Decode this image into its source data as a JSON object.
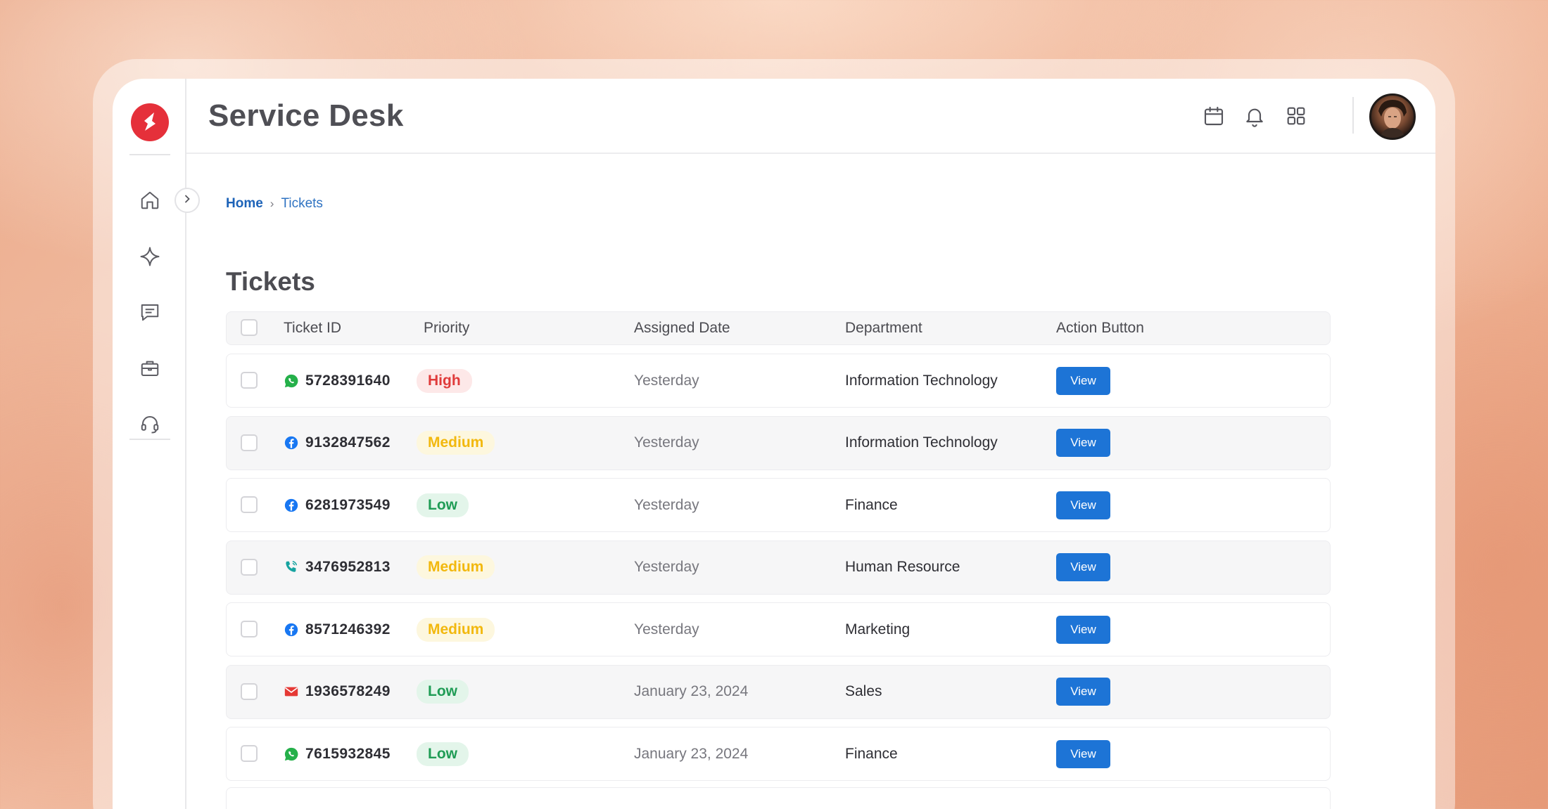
{
  "header": {
    "title": "Service Desk",
    "icons": [
      "calendar-icon",
      "bell-icon",
      "apps-grid-icon"
    ]
  },
  "sidebar": {
    "items": [
      "home-icon",
      "sparkle-icon",
      "chat-icon",
      "briefcase-icon",
      "headset-icon"
    ]
  },
  "breadcrumb": {
    "home": "Home",
    "separator": "›",
    "current": "Tickets"
  },
  "main": {
    "title": "Tickets",
    "columns": [
      "Ticket ID",
      "Priority",
      "Assigned Date",
      "Department",
      "Action Button"
    ],
    "rows": [
      {
        "channel": "whatsapp",
        "id": "5728391640",
        "priority": "High",
        "level": "high",
        "date": "Yesterday",
        "department": "Information Technology",
        "action": "View"
      },
      {
        "channel": "facebook",
        "id": "9132847562",
        "priority": "Medium",
        "level": "medium",
        "date": "Yesterday",
        "department": "Information Technology",
        "action": "View"
      },
      {
        "channel": "facebook",
        "id": "6281973549",
        "priority": "Low",
        "level": "low",
        "date": "Yesterday",
        "department": "Finance",
        "action": "View"
      },
      {
        "channel": "phone",
        "id": "3476952813",
        "priority": "Medium",
        "level": "medium",
        "date": "Yesterday",
        "department": "Human Resource",
        "action": "View"
      },
      {
        "channel": "facebook",
        "id": "8571246392",
        "priority": "Medium",
        "level": "medium",
        "date": "Yesterday",
        "department": "Marketing",
        "action": "View"
      },
      {
        "channel": "email",
        "id": "1936578249",
        "priority": "Low",
        "level": "low",
        "date": "January 23, 2024",
        "department": "Sales",
        "action": "View"
      },
      {
        "channel": "whatsapp",
        "id": "7615932845",
        "priority": "Low",
        "level": "low",
        "date": "January 23, 2024",
        "department": "Finance",
        "action": "View"
      }
    ]
  },
  "colors": {
    "brand": "#e5303a",
    "primary": "#1d74d6",
    "high": "#e03b3b",
    "medium": "#f2b80e",
    "low": "#1f9c55",
    "whatsapp": "#25b04a",
    "facebook": "#1877f2",
    "phone": "#16a3a0",
    "email": "#e53935"
  }
}
